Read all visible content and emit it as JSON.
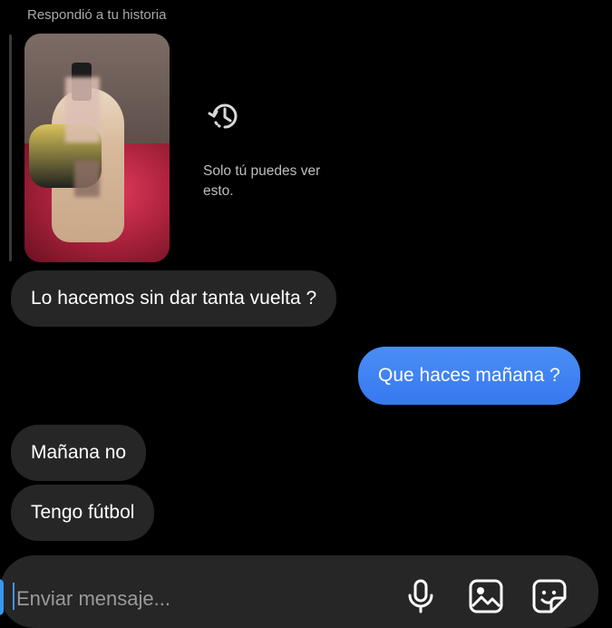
{
  "story": {
    "header": "Respondió a tu historia",
    "note": "Solo tú puedes ver esto.",
    "icons": {
      "history": "history-icon"
    }
  },
  "messages": [
    {
      "direction": "in",
      "text": "Lo hacemos sin dar tanta vuelta ?"
    },
    {
      "direction": "out",
      "text": "Que haces mañana ?"
    },
    {
      "direction": "in",
      "text": "Mañana no"
    },
    {
      "direction": "in",
      "text": "Tengo fútbol"
    }
  ],
  "composer": {
    "placeholder": "Enviar mensaje...",
    "icons": [
      "microphone-icon",
      "gallery-icon",
      "sticker-icon"
    ]
  },
  "colors": {
    "background": "#000000",
    "incoming_bubble": "#262626",
    "outgoing_bubble": "#3b82f6",
    "caret": "#3897f0"
  }
}
